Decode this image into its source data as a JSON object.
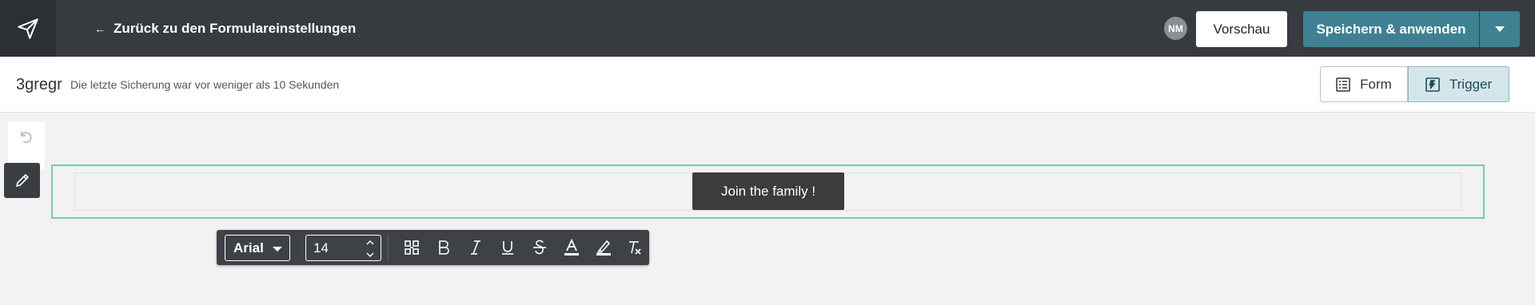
{
  "topbar": {
    "back_label": "Zurück zu den Formulareinstellungen",
    "avatar_initials": "NM",
    "preview_label": "Vorschau",
    "save_label": "Speichern & anwenden"
  },
  "subheader": {
    "form_name": "3gregr",
    "save_status": "Die letzte Sicherung war vor weniger als 10 Sekunden",
    "tabs": [
      {
        "label": "Form",
        "icon": "list-icon",
        "active": false
      },
      {
        "label": "Trigger",
        "icon": "trigger-icon",
        "active": true
      }
    ]
  },
  "canvas": {
    "button_text": "Join the family !"
  },
  "format_toolbar": {
    "font": "Arial",
    "font_size": "14",
    "tools": [
      "link-icon",
      "bold-icon",
      "italic-icon",
      "underline-icon",
      "strikethrough-icon",
      "text-color-icon",
      "highlight-icon",
      "clear-format-icon"
    ]
  },
  "colors": {
    "topbar": "#373b40",
    "accent": "#3f8192",
    "selection_outline": "#78c9ad"
  }
}
